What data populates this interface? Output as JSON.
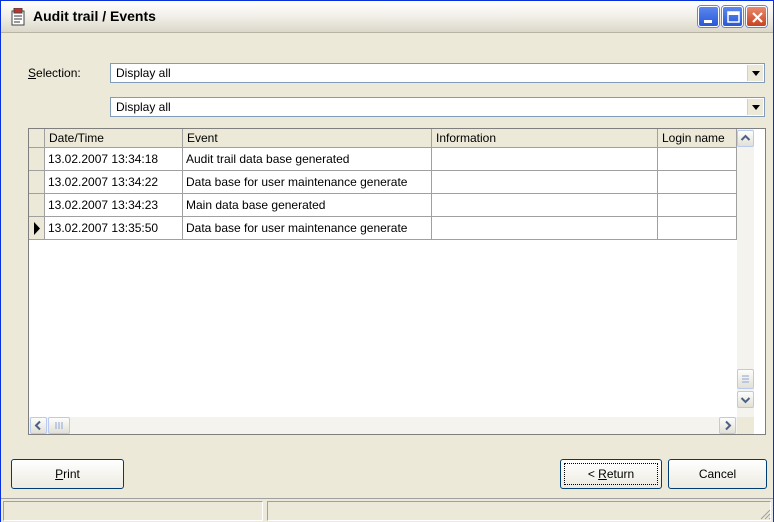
{
  "window": {
    "title": "Audit trail / Events"
  },
  "selection": {
    "label_prefix": "S",
    "label_rest": "election:",
    "filter1_value": "Display all",
    "filter2_value": "Display all"
  },
  "grid": {
    "columns": [
      "Date/Time",
      "Event",
      "Information",
      "Login name"
    ],
    "rows": [
      {
        "datetime": "13.02.2007 13:34:18",
        "event": "Audit trail data base generated",
        "information": "",
        "login": ""
      },
      {
        "datetime": "13.02.2007 13:34:22",
        "event": "Data base for user maintenance generate",
        "information": "",
        "login": ""
      },
      {
        "datetime": "13.02.2007 13:34:23",
        "event": "Main data base generated",
        "information": "",
        "login": ""
      },
      {
        "datetime": "13.02.2007 13:35:50",
        "event": "Data base for user maintenance generate",
        "information": "",
        "login": ""
      }
    ],
    "current_row_index": 3
  },
  "buttons": {
    "print_prefix": "P",
    "print_rest": "rint",
    "return_pre": "< ",
    "return_accel": "R",
    "return_rest": "eturn",
    "cancel": "Cancel"
  },
  "icons": {
    "title": "audit-trail-app-icon",
    "minimize": "minimize-icon",
    "maximize": "maximize-icon",
    "close": "close-icon"
  }
}
